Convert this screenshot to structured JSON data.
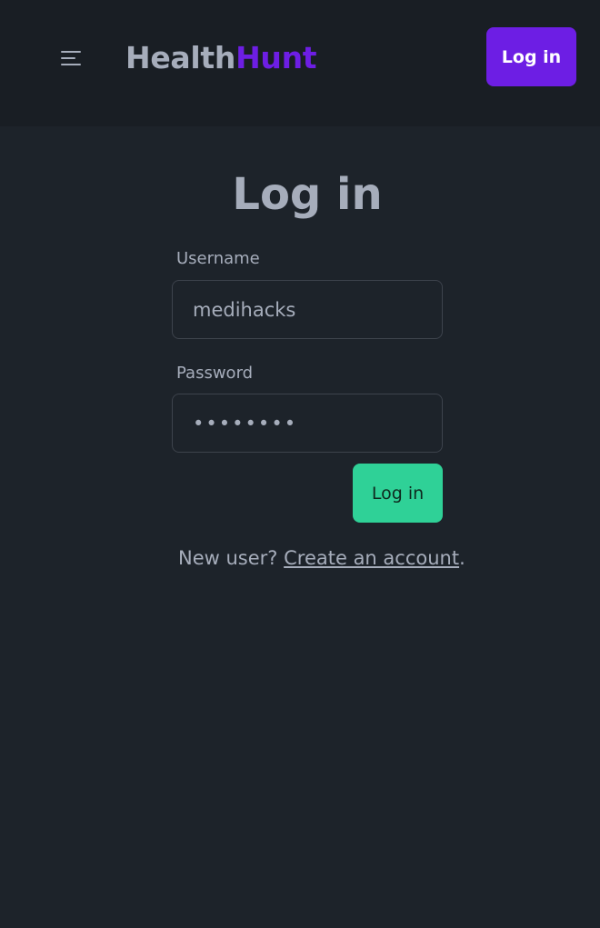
{
  "header": {
    "brand_part1": "Health",
    "brand_part2": "Hunt",
    "login_label": "Log in",
    "menu_icon": "hamburger-menu-icon"
  },
  "form": {
    "title": "Log in",
    "username_label": "Username",
    "username_value": "medihacks",
    "password_label": "Password",
    "password_value": "••••••••",
    "submit_label": "Log in"
  },
  "footer": {
    "prompt": "New user? ",
    "link_text": "Create an account",
    "suffix": "."
  },
  "colors": {
    "background": "#1d232a",
    "navbar": "#191e24",
    "primary": "#6d1ee4",
    "accent": "#2fd197",
    "text": "#a6adbb"
  }
}
